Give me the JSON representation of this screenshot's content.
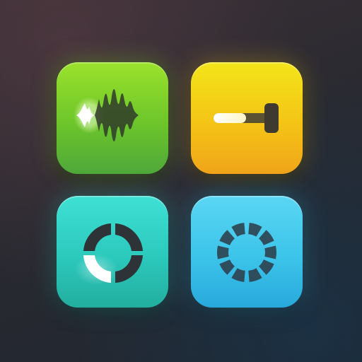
{
  "app_icon": {
    "tiles": [
      {
        "id": "waveform",
        "icon": "waveform-icon",
        "color_top": "#9be22c",
        "color_bottom": "#4fa83a"
      },
      {
        "id": "slider",
        "icon": "slider-icon",
        "color_top": "#f3e51a",
        "color_bottom": "#f0a41a",
        "level": 0.45
      },
      {
        "id": "progress-ring",
        "icon": "progress-ring-icon",
        "color_top": "#3fe0d4",
        "color_bottom": "#22ae9e",
        "segments": 4,
        "highlighted_segments": 1
      },
      {
        "id": "loader",
        "icon": "loading-spinner-icon",
        "color_top": "#5ad6f3",
        "color_bottom": "#28a9dc",
        "segments": 10
      }
    ],
    "background_color": "#2a2a31",
    "icon_dark_color": "#2f3238"
  }
}
